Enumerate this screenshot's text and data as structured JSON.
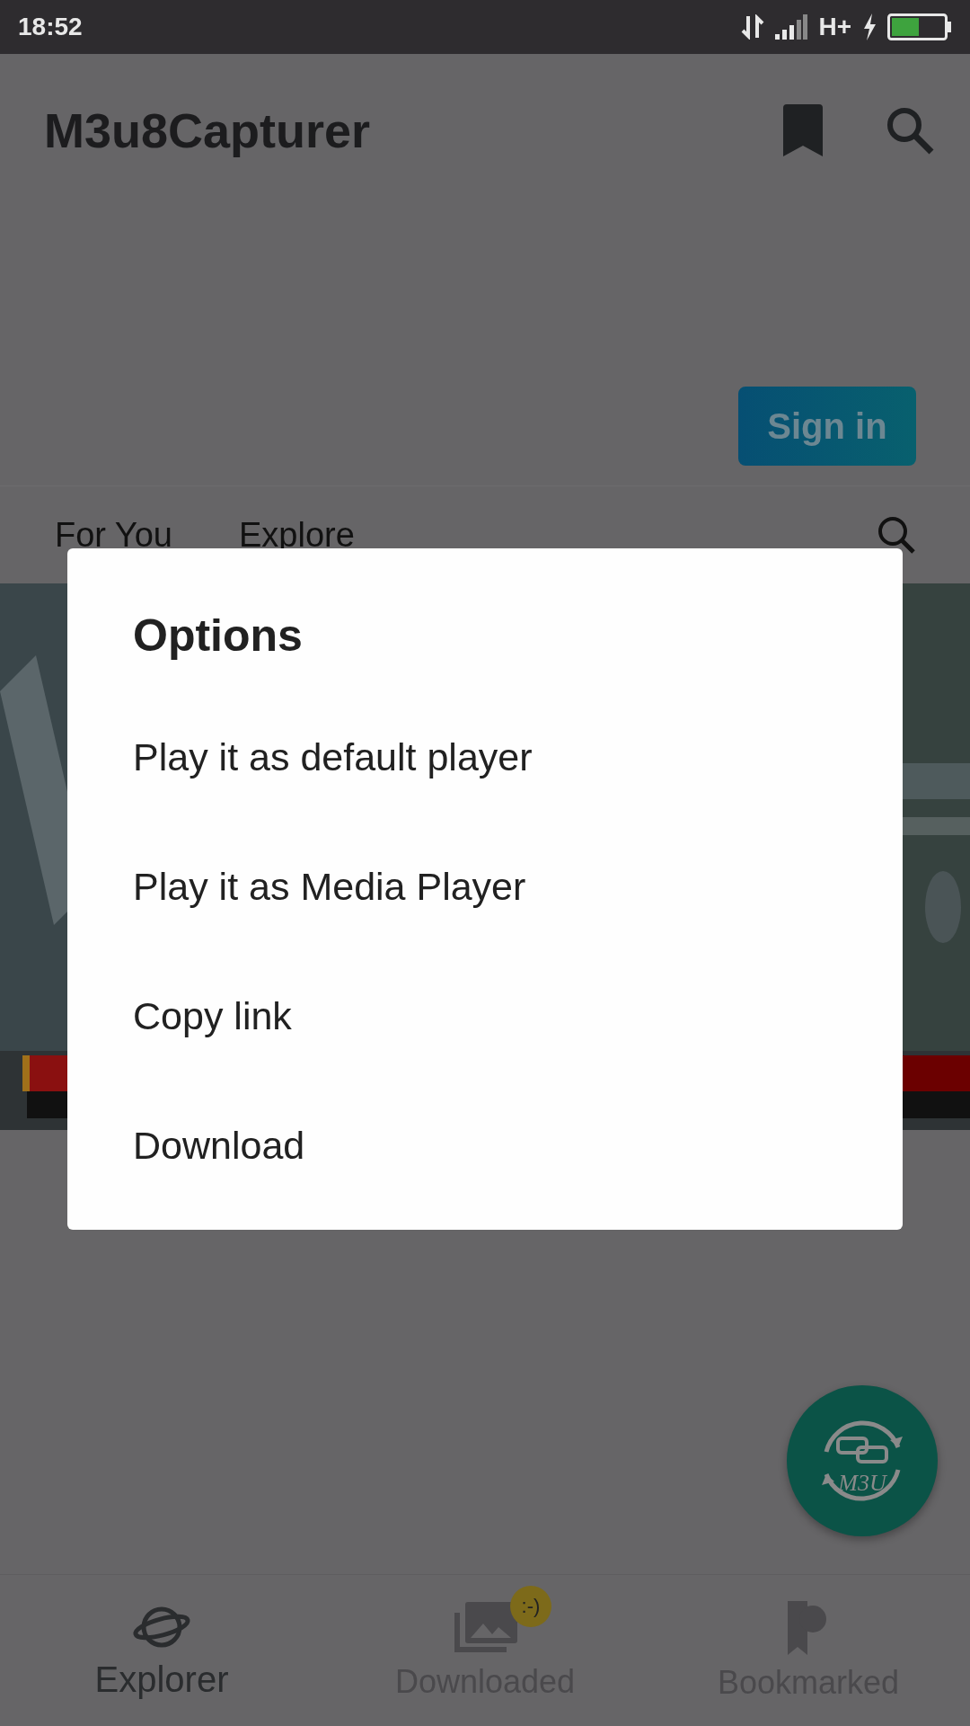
{
  "status_bar": {
    "time": "18:52",
    "network": "H+"
  },
  "app_bar": {
    "title": "M3u8Capturer"
  },
  "web_header": {
    "sign_in": "Sign in"
  },
  "web_tabs": [
    {
      "label": "For You"
    },
    {
      "label": "Explore"
    }
  ],
  "dialog": {
    "title": "Options",
    "items": [
      "Play it as default player",
      "Play it as Media Player",
      "Copy link",
      "Download"
    ]
  },
  "fab": {
    "label": "M3U"
  },
  "bottom_nav": [
    {
      "label": "Explorer",
      "selected": true,
      "kind": "planet"
    },
    {
      "label": "Downloaded",
      "selected": false,
      "kind": "photos",
      "badge": ":-)"
    },
    {
      "label": "Bookmarked",
      "selected": false,
      "kind": "bookmark"
    }
  ]
}
